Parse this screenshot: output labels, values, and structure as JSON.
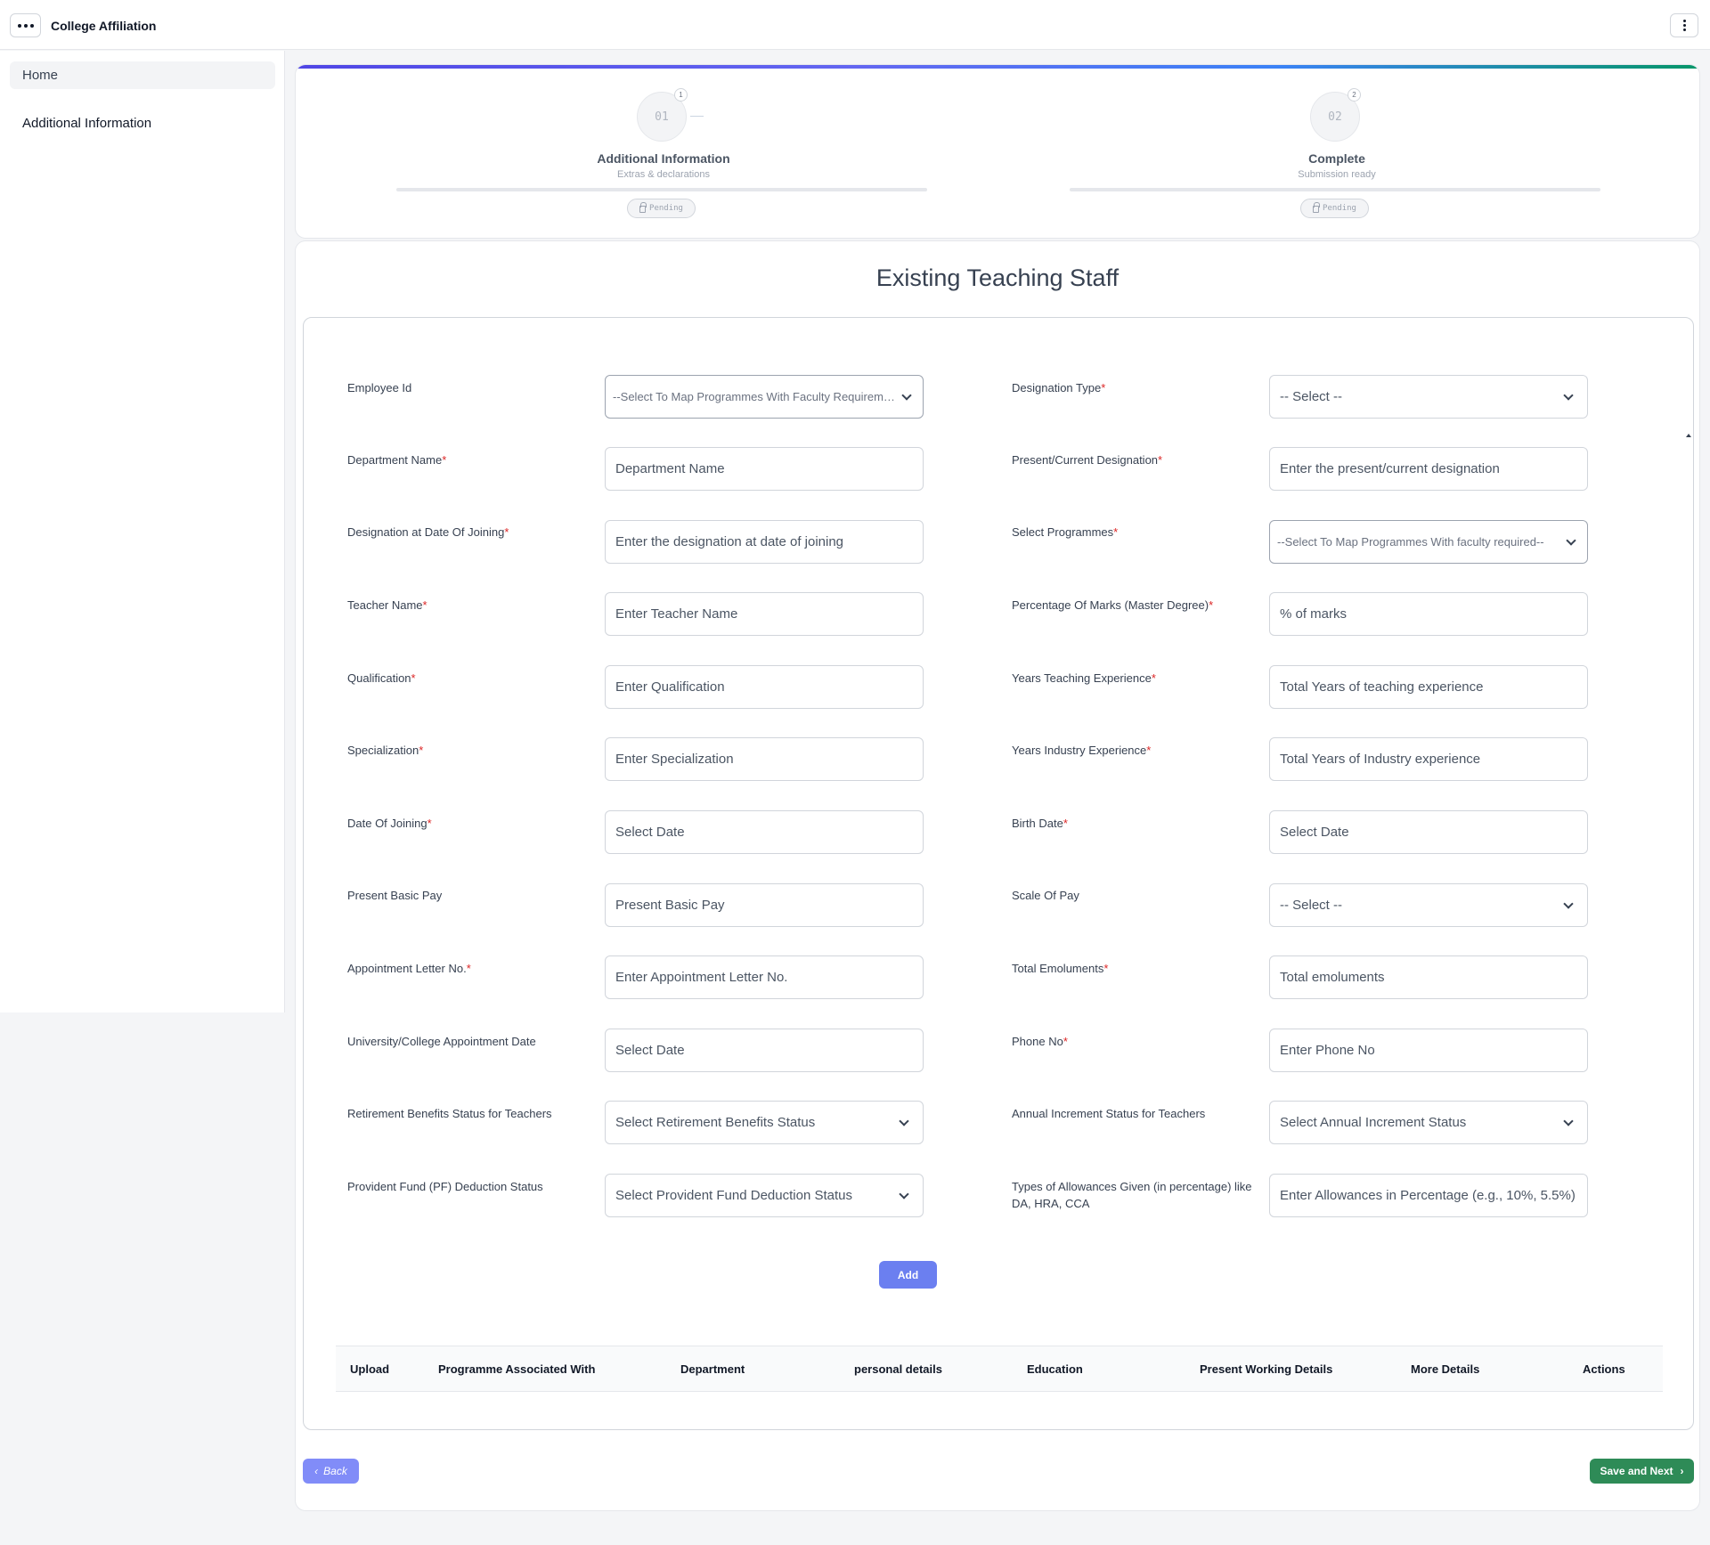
{
  "app": {
    "title": "College Affiliation"
  },
  "sidebar": {
    "items": [
      {
        "label": "Home"
      },
      {
        "label": "Additional Information"
      }
    ]
  },
  "stepper": {
    "steps": [
      {
        "number": "01",
        "badge": "1",
        "title": "Additional Information",
        "subtitle": "Extras & declarations",
        "status": "Pending"
      },
      {
        "number": "02",
        "badge": "2",
        "title": "Complete",
        "subtitle": "Submission ready",
        "status": "Pending"
      }
    ]
  },
  "form": {
    "title": "Existing Teaching Staff",
    "fields": [
      {
        "label": "Employee Id",
        "required": "",
        "value": "--Select To Map Programmes With Faculty Requirements--"
      },
      {
        "label": "Designation Type",
        "required": "*",
        "value": "-- Select --"
      },
      {
        "label": "Department Name",
        "required": "*",
        "placeholder": "Department Name"
      },
      {
        "label": "Present/Current Designation",
        "required": "*",
        "placeholder": "Enter the present/current designation"
      },
      {
        "label": "Designation at Date Of Joining",
        "required": "*",
        "placeholder": "Enter the designation at date of joining"
      },
      {
        "label": "Select Programmes",
        "required": "*",
        "value": "--Select To Map Programmes With faculty required--"
      },
      {
        "label": "Teacher Name",
        "required": "*",
        "placeholder": "Enter Teacher Name"
      },
      {
        "label": "Percentage Of Marks (Master Degree)",
        "required": "*",
        "placeholder": "% of marks"
      },
      {
        "label": "Qualification",
        "required": "*",
        "placeholder": "Enter Qualification"
      },
      {
        "label": "Years Teaching Experience",
        "required": "*",
        "placeholder": "Total Years of teaching experience"
      },
      {
        "label": "Specialization",
        "required": "*",
        "placeholder": "Enter Specialization"
      },
      {
        "label": "Years Industry Experience",
        "required": "*",
        "placeholder": "Total Years of Industry experience"
      },
      {
        "label": "Date Of Joining",
        "required": "*",
        "placeholder": "Select Date"
      },
      {
        "label": "Birth Date",
        "required": "*",
        "placeholder": "Select Date"
      },
      {
        "label": "Present Basic Pay",
        "required": "",
        "placeholder": "Present Basic Pay"
      },
      {
        "label": "Scale Of Pay",
        "required": "",
        "value": "-- Select --"
      },
      {
        "label": "Appointment Letter No.",
        "required": "*",
        "placeholder": "Enter Appointment Letter No."
      },
      {
        "label": "Total Emoluments",
        "required": "*",
        "placeholder": "Total emoluments"
      },
      {
        "label": "University/College Appointment Date",
        "required": "",
        "placeholder": "Select Date"
      },
      {
        "label": "Phone No",
        "required": "*",
        "placeholder": "Enter Phone No"
      },
      {
        "label": "Retirement Benefits Status for Teachers",
        "required": "",
        "value": "Select Retirement Benefits Status"
      },
      {
        "label": "Annual Increment Status for Teachers",
        "required": "",
        "value": "Select Annual Increment Status"
      },
      {
        "label": "Provident Fund (PF) Deduction Status",
        "required": "",
        "value": "Select Provident Fund Deduction Status"
      },
      {
        "label": "Types of Allowances Given (in percentage) like DA, HRA, CCA",
        "required": "",
        "placeholder": "Enter Allowances in Percentage (e.g., 10%, 5.5%)"
      }
    ],
    "add_label": "Add"
  },
  "table": {
    "columns": [
      "Upload",
      "Programme Associated With",
      "Department",
      "personal details",
      "Education",
      "Present Working Details",
      "More Details",
      "Actions"
    ]
  },
  "footer": {
    "back_label": "Back",
    "save_label": "Save and Next"
  }
}
